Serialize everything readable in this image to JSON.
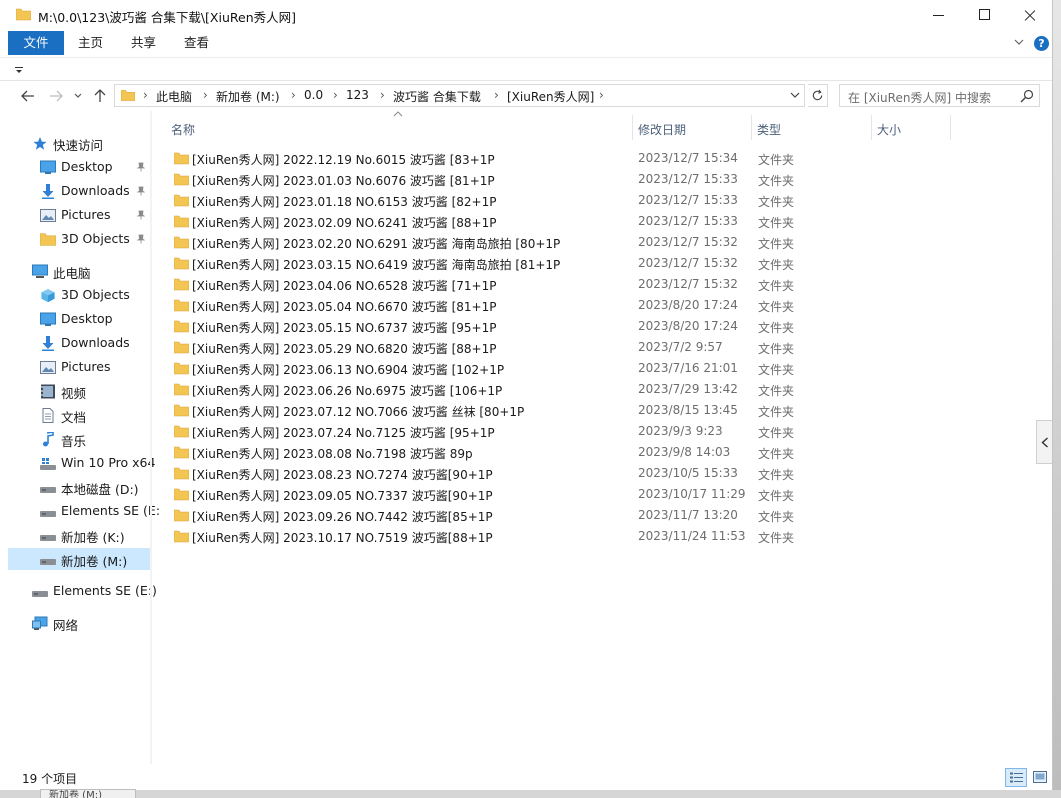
{
  "window": {
    "title": "M:\\0.0\\123\\波巧酱 合集下载\\[XiuRen秀人网]"
  },
  "ribbon": {
    "tabs": [
      "文件",
      "主页",
      "共享",
      "查看"
    ]
  },
  "nav": {
    "breadcrumbs": [
      "此电脑",
      "新加卷 (M:)",
      "0.0",
      "123",
      "波巧酱 合集下载",
      "[XiuRen秀人网]"
    ],
    "search_placeholder": "在 [XiuRen秀人网] 中搜索"
  },
  "sidebar": {
    "items": [
      {
        "label": "快速访问",
        "icon": "star-icon"
      },
      {
        "label": "Desktop",
        "icon": "desktop-icon",
        "pinned": true
      },
      {
        "label": "Downloads",
        "icon": "download-icon",
        "pinned": true
      },
      {
        "label": "Pictures",
        "icon": "pictures-icon",
        "pinned": true
      },
      {
        "label": "3D Objects",
        "icon": "folder-icon",
        "pinned": true
      },
      {
        "label": "此电脑",
        "icon": "computer-icon"
      },
      {
        "label": "3D Objects",
        "icon": "cube-icon"
      },
      {
        "label": "Desktop",
        "icon": "desktop-icon"
      },
      {
        "label": "Downloads",
        "icon": "download-icon"
      },
      {
        "label": "Pictures",
        "icon": "pictures-icon"
      },
      {
        "label": "视频",
        "icon": "video-icon"
      },
      {
        "label": "文档",
        "icon": "document-icon"
      },
      {
        "label": "音乐",
        "icon": "music-icon"
      },
      {
        "label": "Win 10 Pro x64",
        "icon": "system-drive-icon"
      },
      {
        "label": "本地磁盘 (D:)",
        "icon": "drive-icon"
      },
      {
        "label": "Elements SE (E:",
        "icon": "drive-icon"
      },
      {
        "label": "新加卷 (K:)",
        "icon": "drive-icon"
      },
      {
        "label": "新加卷 (M:)",
        "icon": "drive-icon",
        "selected": true
      },
      {
        "label": "Elements SE (E:)",
        "icon": "drive-icon"
      },
      {
        "label": "网络",
        "icon": "network-icon"
      }
    ]
  },
  "columns": {
    "name": "名称",
    "date": "修改日期",
    "type": "类型",
    "size": "大小"
  },
  "files": [
    {
      "name": "[XiuRen秀人网] 2022.12.19 No.6015 波巧酱 [83+1P",
      "date": "2023/12/7 15:34",
      "type": "文件夹"
    },
    {
      "name": "[XiuRen秀人网] 2023.01.03 No.6076 波巧酱 [81+1P",
      "date": "2023/12/7 15:33",
      "type": "文件夹"
    },
    {
      "name": "[XiuRen秀人网] 2023.01.18 NO.6153 波巧酱 [82+1P",
      "date": "2023/12/7 15:33",
      "type": "文件夹"
    },
    {
      "name": "[XiuRen秀人网] 2023.02.09 NO.6241 波巧酱 [88+1P",
      "date": "2023/12/7 15:33",
      "type": "文件夹"
    },
    {
      "name": "[XiuRen秀人网] 2023.02.20 NO.6291 波巧酱 海南岛旅拍 [80+1P",
      "date": "2023/12/7 15:32",
      "type": "文件夹"
    },
    {
      "name": "[XiuRen秀人网] 2023.03.15 NO.6419 波巧酱 海南岛旅拍 [81+1P",
      "date": "2023/12/7 15:32",
      "type": "文件夹"
    },
    {
      "name": "[XiuRen秀人网] 2023.04.06 NO.6528 波巧酱 [71+1P",
      "date": "2023/12/7 15:32",
      "type": "文件夹"
    },
    {
      "name": "[XiuRen秀人网] 2023.05.04 NO.6670 波巧酱 [81+1P",
      "date": "2023/8/20 17:24",
      "type": "文件夹"
    },
    {
      "name": "[XiuRen秀人网] 2023.05.15 NO.6737 波巧酱 [95+1P",
      "date": "2023/8/20 17:24",
      "type": "文件夹"
    },
    {
      "name": "[XiuRen秀人网] 2023.05.29 NO.6820 波巧酱 [88+1P",
      "date": "2023/7/2 9:57",
      "type": "文件夹"
    },
    {
      "name": "[XiuRen秀人网] 2023.06.13 NO.6904 波巧酱 [102+1P",
      "date": "2023/7/16 21:01",
      "type": "文件夹"
    },
    {
      "name": "[XiuRen秀人网] 2023.06.26 No.6975 波巧酱 [106+1P",
      "date": "2023/7/29 13:42",
      "type": "文件夹"
    },
    {
      "name": "[XiuRen秀人网] 2023.07.12 NO.7066 波巧酱 丝袜 [80+1P",
      "date": "2023/8/15 13:45",
      "type": "文件夹"
    },
    {
      "name": "[XiuRen秀人网] 2023.07.24 No.7125 波巧酱 [95+1P",
      "date": "2023/9/3 9:23",
      "type": "文件夹"
    },
    {
      "name": "[XiuRen秀人网] 2023.08.08 No.7198 波巧酱 89p",
      "date": "2023/9/8 14:03",
      "type": "文件夹"
    },
    {
      "name": "[XiuRen秀人网] 2023.08.23 NO.7274 波巧酱[90+1P",
      "date": "2023/10/5 15:33",
      "type": "文件夹"
    },
    {
      "name": "[XiuRen秀人网] 2023.09.05 NO.7337 波巧酱[90+1P",
      "date": "2023/10/17 11:29",
      "type": "文件夹"
    },
    {
      "name": "[XiuRen秀人网] 2023.09.26 NO.7442 波巧酱[85+1P",
      "date": "2023/11/7 13:20",
      "type": "文件夹"
    },
    {
      "name": "[XiuRen秀人网] 2023.10.17 NO.7519 波巧酱[88+1P",
      "date": "2023/11/24 11:53",
      "type": "文件夹"
    }
  ],
  "status": {
    "item_count": "19 个项目"
  },
  "background": {
    "ghost_label": "新加卷 (M:)"
  },
  "colors": {
    "accent": "#1a6fc2",
    "folder": "#f3c552",
    "selected": "#cce8ff",
    "header_text": "#4c607a"
  }
}
